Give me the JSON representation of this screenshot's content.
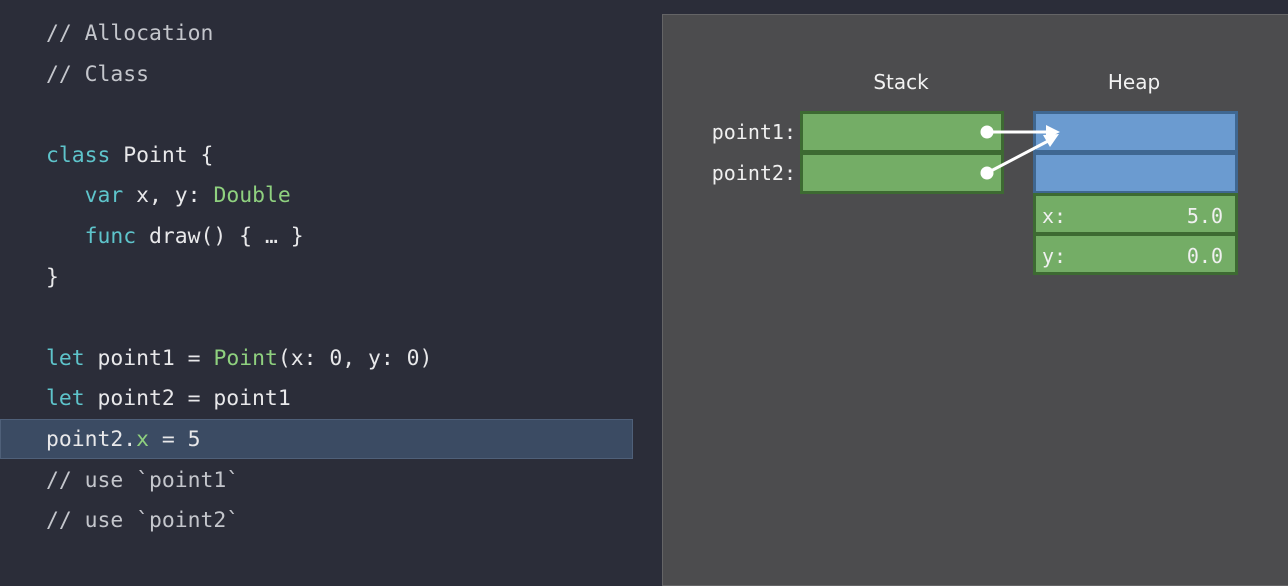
{
  "code": [
    [
      {
        "t": "// Allocation",
        "c": "cm"
      }
    ],
    [
      {
        "t": "// Class",
        "c": "cm"
      }
    ],
    [],
    [
      {
        "t": "class",
        "c": "kw"
      },
      {
        "t": " Point {",
        "c": "tx"
      }
    ],
    [
      {
        "t": "   "
      },
      {
        "t": "var",
        "c": "kw"
      },
      {
        "t": " x, y: ",
        "c": "tx"
      },
      {
        "t": "Double",
        "c": "ty"
      }
    ],
    [
      {
        "t": "   "
      },
      {
        "t": "func",
        "c": "kw"
      },
      {
        "t": " draw() { … }",
        "c": "tx"
      }
    ],
    [
      {
        "t": "}",
        "c": "tx"
      }
    ],
    [],
    [
      {
        "t": "let",
        "c": "kw"
      },
      {
        "t": " point1 = ",
        "c": "tx"
      },
      {
        "t": "Point",
        "c": "ty"
      },
      {
        "t": "(x: 0, y: 0)",
        "c": "tx"
      }
    ],
    [
      {
        "t": "let",
        "c": "kw"
      },
      {
        "t": " point2 = point1",
        "c": "tx"
      }
    ],
    [
      {
        "t": "point2.",
        "c": "tx"
      },
      {
        "t": "x",
        "c": "ty"
      },
      {
        "t": " = 5",
        "c": "tx"
      }
    ],
    [
      {
        "t": "// use `point1`",
        "c": "cm"
      }
    ],
    [
      {
        "t": "// use `point2`",
        "c": "cm"
      }
    ]
  ],
  "highlighted_line": 10,
  "diagram": {
    "stack_title": "Stack",
    "heap_title": "Heap",
    "stack_labels": [
      "point1:",
      "point2:"
    ],
    "heap_fields": [
      {
        "name": "x:",
        "value": "5.0"
      },
      {
        "name": "y:",
        "value": "0.0"
      }
    ]
  }
}
